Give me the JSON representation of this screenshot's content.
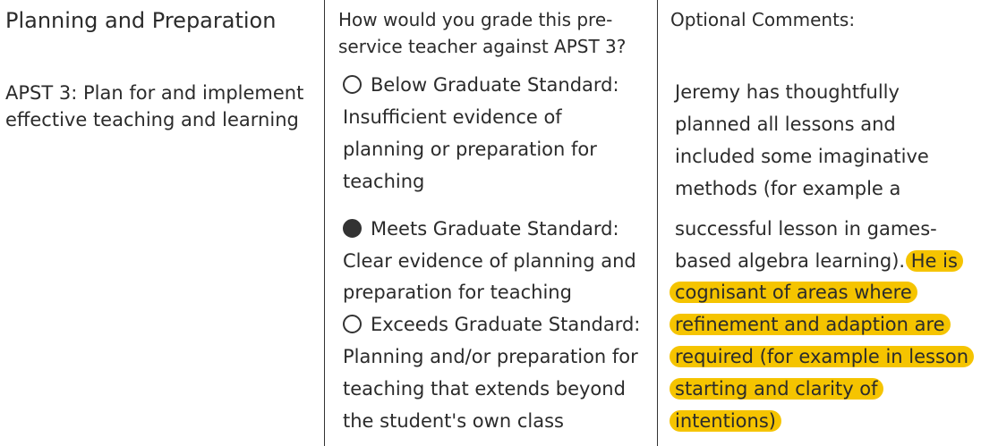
{
  "criterion": {
    "title": "Planning and Preparation",
    "standard_lines": [
      "APST 3: Plan for and implement",
      "effective teaching and learning"
    ]
  },
  "question": {
    "lines": [
      "How would you grade this pre-",
      "service teacher against APST 3?"
    ]
  },
  "options": [
    {
      "selected": false,
      "label": "Below Graduate Standard:",
      "desc_lines": [
        "Insufficient evidence of",
        "planning or preparation for",
        "teaching"
      ]
    },
    {
      "selected": true,
      "label": "Meets Graduate Standard:",
      "desc_lines": [
        "Clear evidence of planning and",
        "preparation for teaching"
      ]
    },
    {
      "selected": false,
      "label": "Exceeds Graduate Standard:",
      "desc_lines": [
        "Planning and/or preparation for",
        "teaching that extends beyond",
        "the student's own class"
      ]
    }
  ],
  "comments": {
    "heading": "Optional Comments:",
    "lines": [
      "Jeremy has thoughtfully",
      "planned all lessons and",
      "included some imaginative",
      "methods (for example a",
      "successful lesson in games-",
      "based algebra learning)."
    ],
    "highlighted_first": "He is",
    "highlighted_lines": [
      "cognisant of areas where",
      "refinement and adaption are",
      "required (for example in lesson",
      "starting and clarity of",
      "intentions)"
    ],
    "highlight_color": "#f5c400"
  }
}
